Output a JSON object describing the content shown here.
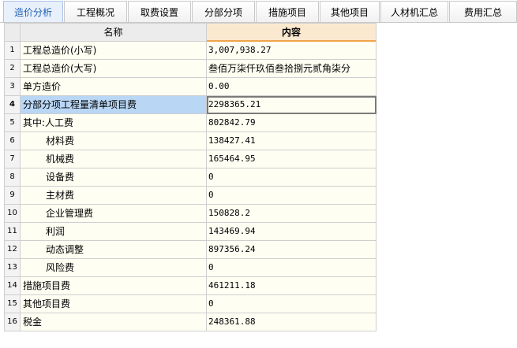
{
  "tabs": [
    "造价分析",
    "工程概况",
    "取费设置",
    "分部分项",
    "措施项目",
    "其他项目",
    "人材机汇总",
    "费用汇总"
  ],
  "active_tab": 0,
  "table": {
    "headers": {
      "name": "名称",
      "value": "内容"
    },
    "rows": [
      {
        "no": "1",
        "name": "工程总造价(小写)",
        "value": "3,007,938.27"
      },
      {
        "no": "2",
        "name": "工程总造价(大写)",
        "value": "叁佰万柒仟玖佰叁拾捌元贰角柒分"
      },
      {
        "no": "3",
        "name": "单方造价",
        "value": "0.00"
      },
      {
        "no": "4",
        "name": "分部分项工程量清单项目费",
        "value": "2298365.21"
      },
      {
        "no": "5",
        "name": "其中:人工费",
        "value": "802842.79"
      },
      {
        "no": "6",
        "name": "材料费",
        "value": "138427.41"
      },
      {
        "no": "7",
        "name": "机械费",
        "value": "165464.95"
      },
      {
        "no": "8",
        "name": "设备费",
        "value": "0"
      },
      {
        "no": "9",
        "name": "主材费",
        "value": "0"
      },
      {
        "no": "10",
        "name": "企业管理费",
        "value": "150828.2"
      },
      {
        "no": "11",
        "name": "利润",
        "value": "143469.94"
      },
      {
        "no": "12",
        "name": "动态调整",
        "value": "897356.24"
      },
      {
        "no": "13",
        "name": "风险费",
        "value": "0"
      },
      {
        "no": "14",
        "name": "措施项目费",
        "value": "461211.18"
      },
      {
        "no": "15",
        "name": "其他项目费",
        "value": "0"
      },
      {
        "no": "16",
        "name": "税金",
        "value": "248361.88"
      }
    ]
  }
}
